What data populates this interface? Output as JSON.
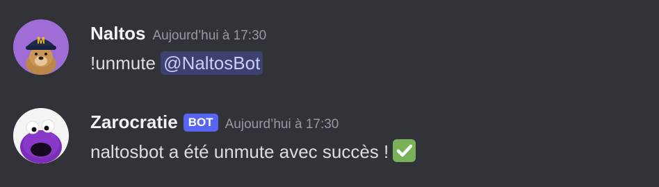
{
  "messages": [
    {
      "username": "Naltos",
      "timestamp": "Aujourd’hui à 17:30",
      "text_prefix": "!unmute ",
      "mention": "@NaltosBot",
      "avatar_icon": "dog-with-mcdonalds-cap-avatar"
    },
    {
      "username": "Zarocratie",
      "bot_tag": "BOT",
      "timestamp": "Aujourd’hui à 17:30",
      "text": "naltosbot a été unmute avec succès !",
      "emoji": "white-check-mark-emoji",
      "avatar_icon": "purple-monster-avatar"
    }
  ],
  "colors": {
    "background": "#313338",
    "username": "#f2f3f5",
    "timestamp": "#949ba4",
    "message_text": "#dbdee1",
    "bot_tag": "#5865f2",
    "mention_text": "#c9cdfb"
  }
}
